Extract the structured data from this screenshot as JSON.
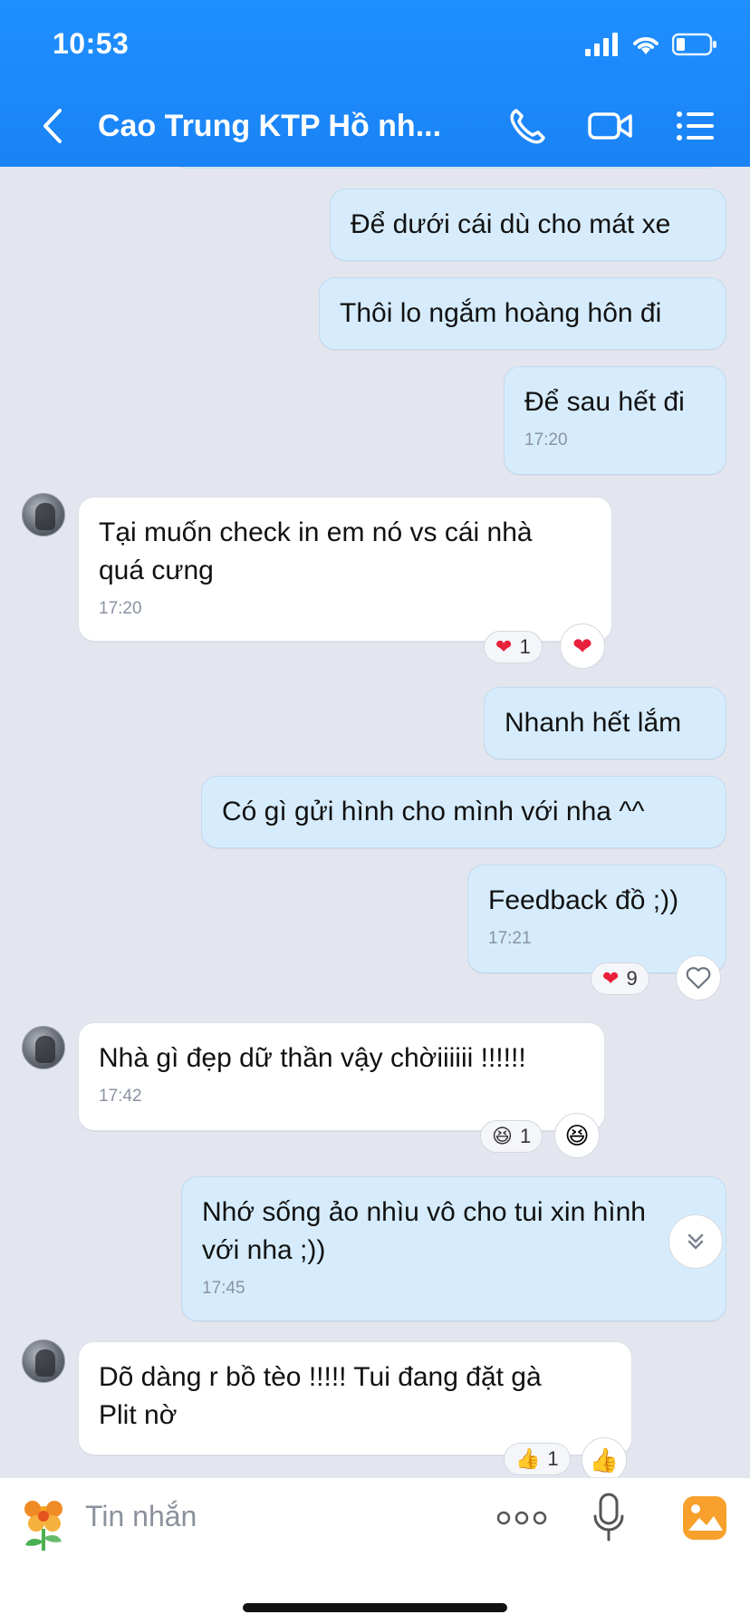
{
  "status": {
    "time": "10:53"
  },
  "header": {
    "title": "Cao Trung  KTP Hồ nh..."
  },
  "messages": [
    {
      "text": "Để dưới cái dù cho mát xe"
    },
    {
      "text": "Thôi lo ngắm hoàng hôn đi"
    },
    {
      "text": "Để sau hết đi",
      "time": "17:20"
    },
    {
      "text": "Tại muốn check in em nó vs cái nhà\nquá cưng",
      "time": "17:20",
      "reaction_count": "1"
    },
    {
      "text": "Nhanh hết lắm"
    },
    {
      "text": "Có gì gửi hình cho mình với nha ^^"
    },
    {
      "text": "Feedback đồ ;))",
      "time": "17:21",
      "reaction_count": "9"
    },
    {
      "text": "Nhà gì đẹp dữ thần vậy chờiiiiii !!!!!!",
      "time": "17:42",
      "reaction_count": "1"
    },
    {
      "text": "Nhớ sống ảo nhìu vô cho tui xin hình\nvới nha ;))",
      "time": "17:45"
    },
    {
      "text": "Dõ dàng r bồ tèo !!!!! Tui đang đặt gà\nPlit nờ",
      "reaction_count": "1"
    }
  ],
  "composer": {
    "placeholder": "Tin nhắn"
  },
  "colors": {
    "header": "#1a83f5",
    "sent_bubble": "#d6ecfc",
    "recv_bubble": "#ffffff",
    "background": "#e3e6ef"
  }
}
